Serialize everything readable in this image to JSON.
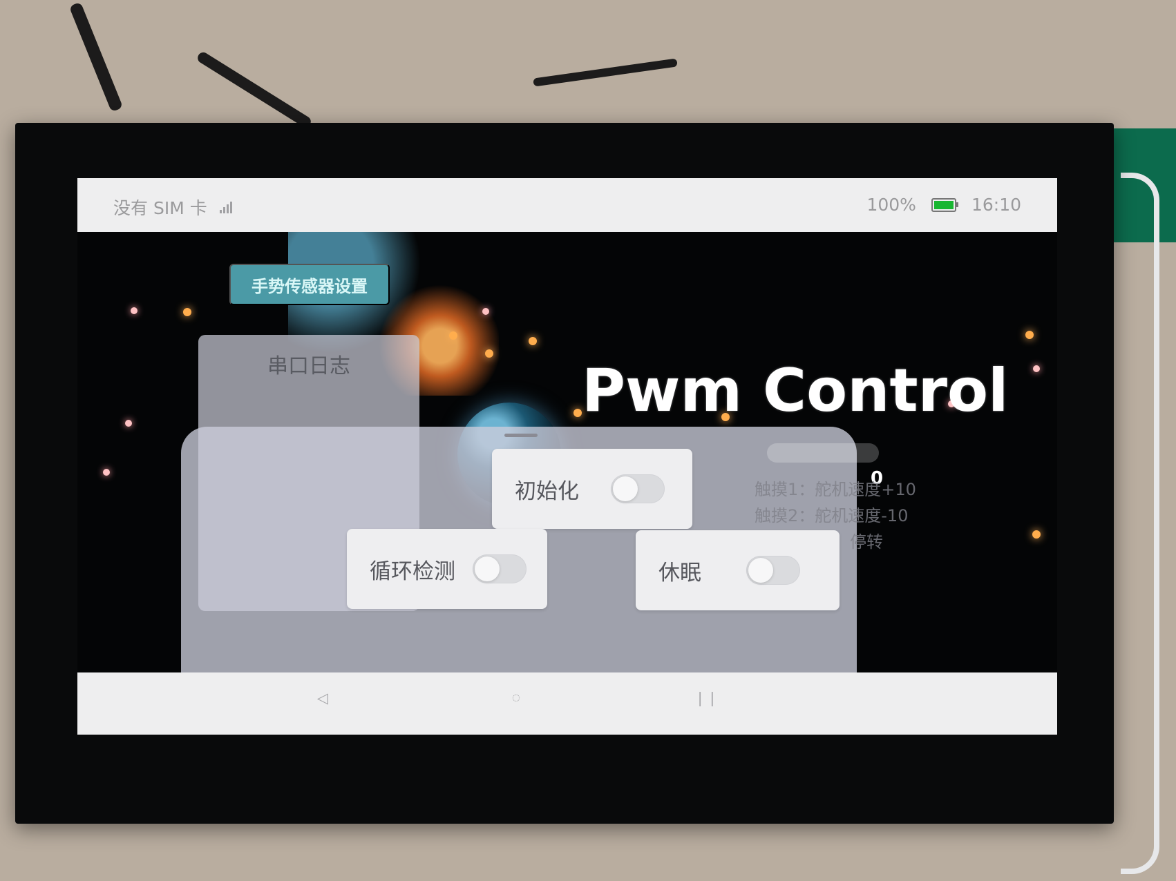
{
  "status_bar": {
    "carrier": "没有 SIM 卡",
    "battery": "100%",
    "time": "16:10",
    "battery_color": "#18b631"
  },
  "buttons": {
    "gesture_settings": "手势传感器设置"
  },
  "panels": {
    "serial_log_title": "串口日志"
  },
  "main": {
    "title": "Pwm Control",
    "value_fragment": "0"
  },
  "gesture_list": [
    "触摸1：舵机速度+10",
    "触摸2：舵机速度-10",
    "停转"
  ],
  "switches": [
    {
      "label": "初始化",
      "state": "off"
    },
    {
      "label": "循环检测",
      "state": "off"
    },
    {
      "label": "休眠",
      "state": "off"
    }
  ],
  "navigation": {
    "back_icon": "◁",
    "home_icon": "◌",
    "recent_icon": "❘❘"
  },
  "colors": {
    "accent": "#4b9aa6",
    "status_text": "#9a9a9c",
    "star_orange": "#ffad4d",
    "star_pink": "#ffc2c4"
  }
}
